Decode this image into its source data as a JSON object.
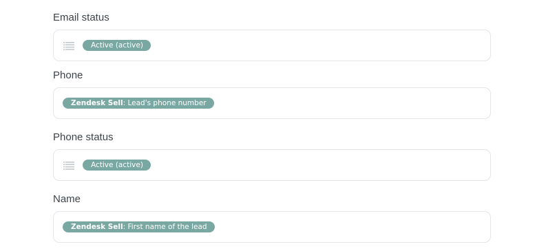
{
  "fields": [
    {
      "label": "Email status",
      "has_list_icon": true,
      "icon": "list-icon",
      "pill": {
        "source": "",
        "text": "Active (active)"
      }
    },
    {
      "label": "Phone",
      "has_list_icon": false,
      "pill": {
        "source": "Zendesk Sell",
        "text": ": Lead's phone number"
      }
    },
    {
      "label": "Phone status",
      "has_list_icon": true,
      "icon": "list-icon",
      "pill": {
        "source": "",
        "text": "Active (active)"
      }
    },
    {
      "label": "Name",
      "has_list_icon": false,
      "pill": {
        "source": "Zendesk Sell",
        "text": ": First name of the lead"
      }
    }
  ],
  "colors": {
    "pill_background": "#79a8a3",
    "field_border": "#e3e6ea",
    "label_text": "#3d434a",
    "icon": "#c3c8cd"
  }
}
